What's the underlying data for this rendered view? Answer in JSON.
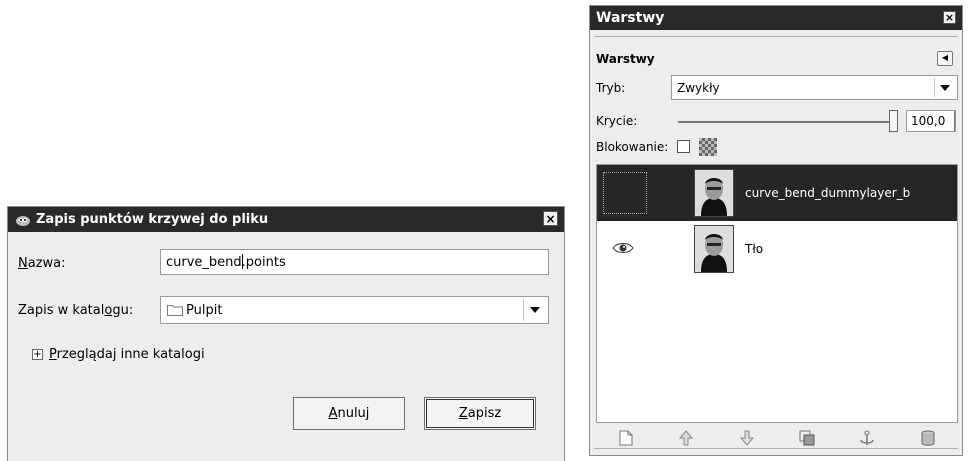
{
  "save_dialog": {
    "title": "Zapis punktów krzywej do pliku",
    "close_label": "×",
    "name_label_underlined": "N",
    "name_label_rest": "azwa:",
    "name_value_before_caret": "curve_bend",
    "name_value_after_caret": ".points",
    "folder_label_pre": "Zapis w katal",
    "folder_label_underlined": "o",
    "folder_label_post": "gu:",
    "folder_value": "Pulpit",
    "browse_underlined": "P",
    "browse_rest": "rzeglądaj inne katalogi",
    "expander_symbol": "+",
    "cancel_underlined": "A",
    "cancel_rest": "nuluj",
    "save_underlined": "Z",
    "save_rest": "apisz"
  },
  "layers_dock": {
    "window_title": "Warstwy",
    "close_label": "×",
    "panel_title": "Warstwy",
    "panel_menu_symbol": "◀",
    "mode_label": "Tryb:",
    "mode_value": "Zwykły",
    "opacity_label": "Krycie:",
    "opacity_value": "100,0",
    "opacity_fraction": 1.0,
    "lock_label": "Blokowanie:",
    "layers": [
      {
        "name": "curve_bend_dummylayer_b",
        "selected": true,
        "visible": false
      },
      {
        "name": "Tło",
        "selected": false,
        "visible": true
      }
    ],
    "footer_icons": [
      "new-layer-icon",
      "raise-layer-icon",
      "lower-layer-icon",
      "duplicate-layer-icon",
      "anchor-layer-icon",
      "delete-layer-icon"
    ]
  }
}
